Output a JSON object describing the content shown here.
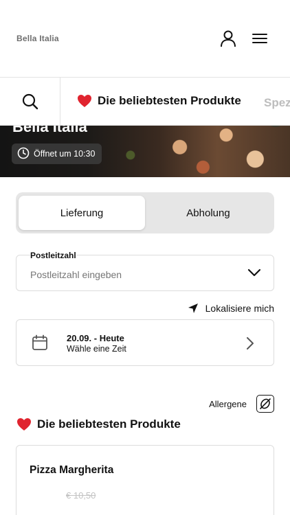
{
  "header": {
    "brand": "Bella Italia",
    "icons": {
      "user": "user-icon",
      "menu": "hamburger-menu-icon"
    }
  },
  "hero": {
    "title": "Bella Italia",
    "opening": "Öffnet um 10:30",
    "opening_icon": "clock-icon"
  },
  "category_bar": {
    "search_icon": "search-icon",
    "tabs": [
      {
        "label": "Die beliebtesten Produkte",
        "icon": "heart-icon",
        "active": true
      },
      {
        "label": "Spez",
        "active": false
      }
    ]
  },
  "order_mode": {
    "options": [
      "Lieferung",
      "Abholung"
    ],
    "selected": "Lieferung"
  },
  "postal": {
    "label": "Postleitzahl",
    "placeholder": "Postleitzahl eingeben",
    "value": ""
  },
  "locate": {
    "label": "Lokalisiere mich",
    "icon": "location-arrow-icon"
  },
  "date": {
    "main": "20.09. - Heute",
    "sub": "Wähle eine Zeit",
    "icon": "calendar-icon"
  },
  "allergens": {
    "label": "Allergene",
    "icon": "allergen-icon"
  },
  "section": {
    "title": "Die beliebtesten Produkte",
    "icon": "heart-icon"
  },
  "products": [
    {
      "name": "Pizza Margherita",
      "old_price": "€ 10,50"
    }
  ],
  "colors": {
    "heart": "#e0242f",
    "muted": "#bdbdbd",
    "border": "#dcdcdc",
    "toggle_bg": "#e6e6e6"
  }
}
